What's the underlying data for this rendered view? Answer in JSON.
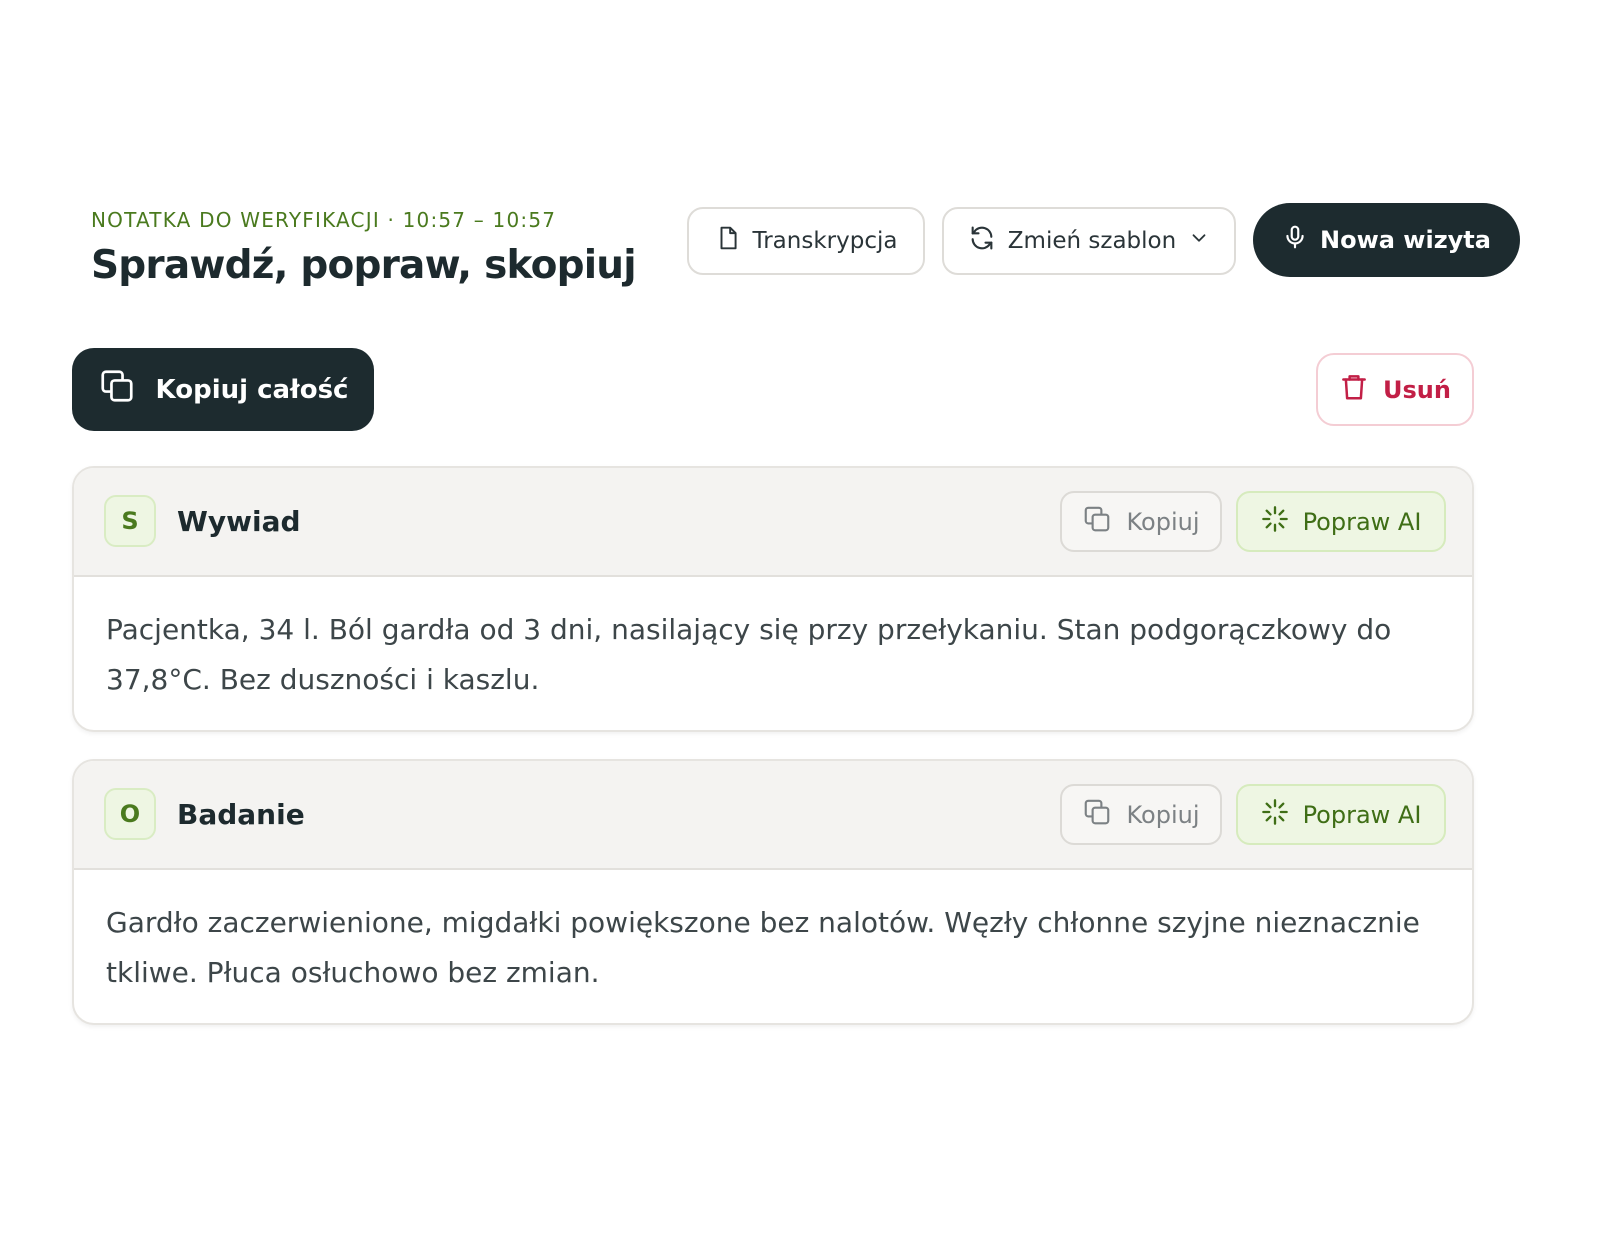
{
  "header": {
    "eyebrow": "NOTATKA DO WERYFIKACJI · 10:57 – 10:57",
    "title": "Sprawdź, popraw, skopiuj"
  },
  "toolbar": {
    "transcription_label": "Transkrypcja",
    "change_template_label": "Zmień szablon",
    "new_visit_label": "Nowa wizyta",
    "copy_all_label": "Kopiuj całość",
    "delete_label": "Usuń"
  },
  "sections": [
    {
      "badge": "S",
      "title": "Wywiad",
      "copy_label": "Kopiuj",
      "ai_label": "Popraw AI",
      "text": "Pacjentka, 34 l. Ból gardła od 3 dni, nasilający się przy przełykaniu. Stan podgorączkowy do 37,8°C. Bez duszności i kaszlu."
    },
    {
      "badge": "O",
      "title": "Badanie",
      "copy_label": "Kopiuj",
      "ai_label": "Popraw AI",
      "text": "Gardło zaczerwienione, migdałki powiększone bez nalotów. Węzły chłonne szyjne nieznacznie tkliwe. Płuca osłuchowo bez zmian."
    }
  ],
  "colors": {
    "accent_green": "#4a7a1e",
    "dark": "#1d2b2f",
    "danger": "#c21f46",
    "ai_bg": "#eef6e3"
  },
  "icons": {
    "transcription": "document-icon",
    "change_template": "refresh-icon",
    "dropdown": "chevron-down-icon",
    "new_visit": "microphone-icon",
    "copy": "copy-icon",
    "delete": "trash-icon",
    "ai": "sparkle-icon"
  }
}
